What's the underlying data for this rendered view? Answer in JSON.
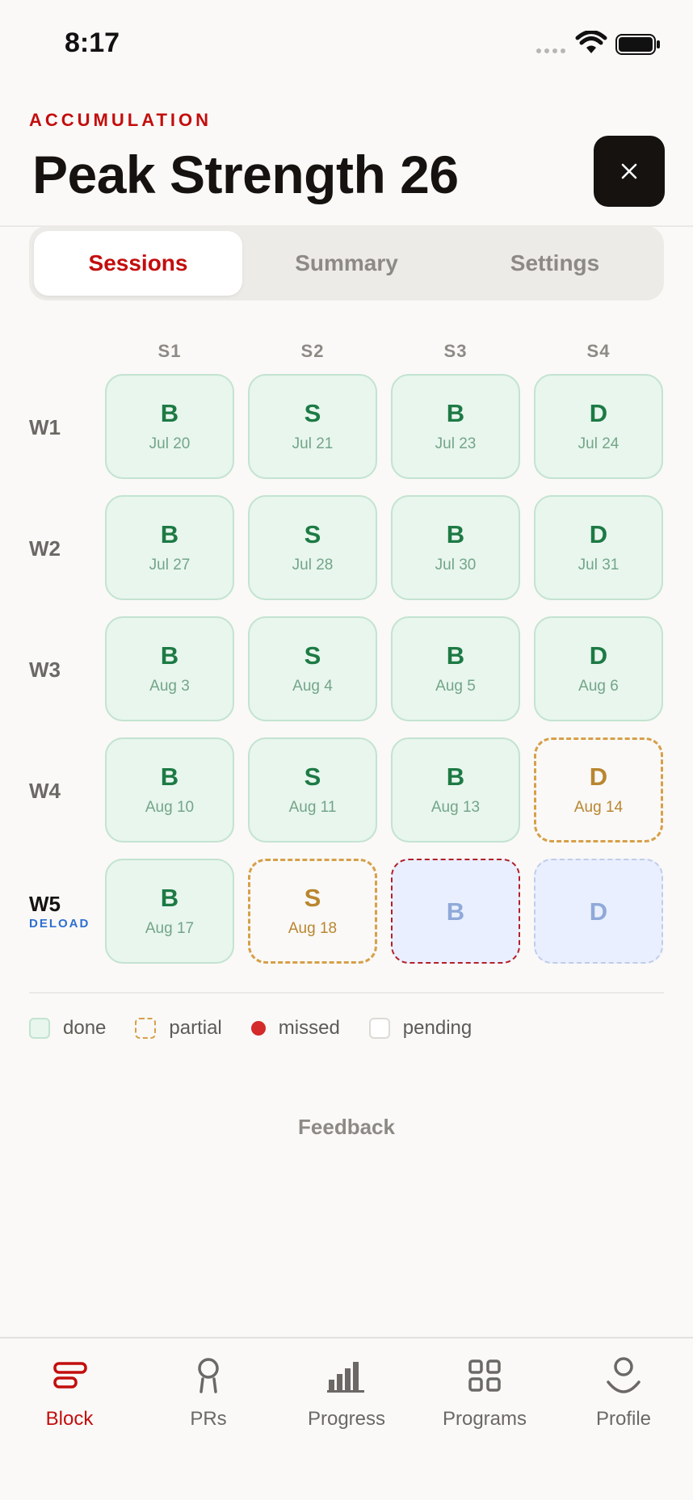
{
  "status_bar": {
    "time": "8:17"
  },
  "header": {
    "phase": "ACCUMULATION",
    "title": "Peak Strength 26"
  },
  "tabs": [
    {
      "label": "Sessions",
      "active": true
    },
    {
      "label": "Summary",
      "active": false
    },
    {
      "label": "Settings",
      "active": false
    }
  ],
  "grid": {
    "columns": [
      "S1",
      "S2",
      "S3",
      "S4"
    ],
    "rows": [
      {
        "label": "W1",
        "tag": "",
        "cells": [
          {
            "letter": "B",
            "date": "Jul 20",
            "status": "done"
          },
          {
            "letter": "S",
            "date": "Jul 21",
            "status": "done"
          },
          {
            "letter": "B",
            "date": "Jul 23",
            "status": "done"
          },
          {
            "letter": "D",
            "date": "Jul 24",
            "status": "done"
          }
        ]
      },
      {
        "label": "W2",
        "tag": "",
        "cells": [
          {
            "letter": "B",
            "date": "Jul 27",
            "status": "done"
          },
          {
            "letter": "S",
            "date": "Jul 28",
            "status": "done"
          },
          {
            "letter": "B",
            "date": "Jul 30",
            "status": "done"
          },
          {
            "letter": "D",
            "date": "Jul 31",
            "status": "done"
          }
        ]
      },
      {
        "label": "W3",
        "tag": "",
        "cells": [
          {
            "letter": "B",
            "date": "Aug 3",
            "status": "done"
          },
          {
            "letter": "S",
            "date": "Aug 4",
            "status": "done"
          },
          {
            "letter": "B",
            "date": "Aug 5",
            "status": "done"
          },
          {
            "letter": "D",
            "date": "Aug 6",
            "status": "done"
          }
        ]
      },
      {
        "label": "W4",
        "tag": "",
        "cells": [
          {
            "letter": "B",
            "date": "Aug 10",
            "status": "done"
          },
          {
            "letter": "S",
            "date": "Aug 11",
            "status": "done"
          },
          {
            "letter": "B",
            "date": "Aug 13",
            "status": "done"
          },
          {
            "letter": "D",
            "date": "Aug 14",
            "status": "partial"
          }
        ]
      },
      {
        "label": "W5",
        "tag": "DELOAD",
        "cells": [
          {
            "letter": "B",
            "date": "Aug 17",
            "status": "done"
          },
          {
            "letter": "S",
            "date": "Aug 18",
            "status": "partial"
          },
          {
            "letter": "B",
            "date": "",
            "status": "missed"
          },
          {
            "letter": "D",
            "date": "",
            "status": "pending"
          }
        ]
      }
    ]
  },
  "legend": [
    {
      "key": "done",
      "label": "done"
    },
    {
      "key": "partial",
      "label": "partial"
    },
    {
      "key": "missed",
      "label": "missed"
    },
    {
      "key": "pending",
      "label": "pending"
    }
  ],
  "feedback_label": "Feedback",
  "nav": [
    {
      "label": "Block",
      "icon": "block-icon",
      "active": true
    },
    {
      "label": "PRs",
      "icon": "trophy-icon",
      "active": false
    },
    {
      "label": "Progress",
      "icon": "bar-chart-icon",
      "active": false
    },
    {
      "label": "Programs",
      "icon": "grid-icon",
      "active": false
    },
    {
      "label": "Profile",
      "icon": "person-icon",
      "active": false
    }
  ],
  "colors": {
    "accent": "#c30d0d",
    "done_bg": "#e8f6ee",
    "done_text": "#1d7a44",
    "partial": "#d6a04a",
    "missed": "#b3202a",
    "pending_bg": "#e9efff",
    "deload": "#2e6fd1"
  }
}
